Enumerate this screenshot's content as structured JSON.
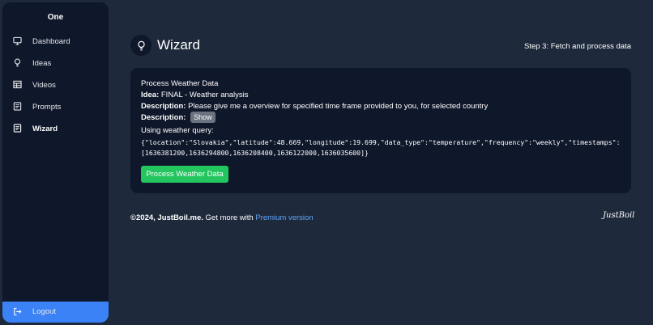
{
  "sidebar": {
    "brand": "One",
    "items": [
      {
        "label": "Dashboard",
        "icon": "monitor-icon"
      },
      {
        "label": "Ideas",
        "icon": "lightbulb-icon"
      },
      {
        "label": "Videos",
        "icon": "table-icon"
      },
      {
        "label": "Prompts",
        "icon": "document-icon"
      },
      {
        "label": "Wizard",
        "icon": "document-icon",
        "active": true
      }
    ],
    "logout_label": "Logout"
  },
  "header": {
    "icon": "lightbulb-icon",
    "title": "Wizard",
    "step": "Step 3: Fetch and process data"
  },
  "card": {
    "heading": "Process Weather Data",
    "idea_label": "Idea:",
    "idea_value": "FINAL - Weather analysis",
    "description_label": "Description:",
    "description_value": "Please give me a overview for specified time frame provided to you, for selected country",
    "description2_label": "Description:",
    "show_button": "Show",
    "query_label": "Using weather query:",
    "query_line1": "{\"location\":\"Slovakia\",\"latitude\":48.669,\"longitude\":19.699,\"data_type\":\"temperature\",\"frequency\":\"weekly\",\"timestamps\":",
    "query_line2": "[1636381200,1636294800,1636208400,1636122000,1636035600]}",
    "process_button": "Process Weather Data"
  },
  "footer": {
    "copyright": "©2024, JustBoil.me.",
    "text": " Get more with ",
    "link": "Premium version",
    "logo": "JustBoil"
  },
  "colors": {
    "background": "#1e293b",
    "panel": "#0f172a",
    "accent": "#3b82f6",
    "success": "#22c55e"
  }
}
